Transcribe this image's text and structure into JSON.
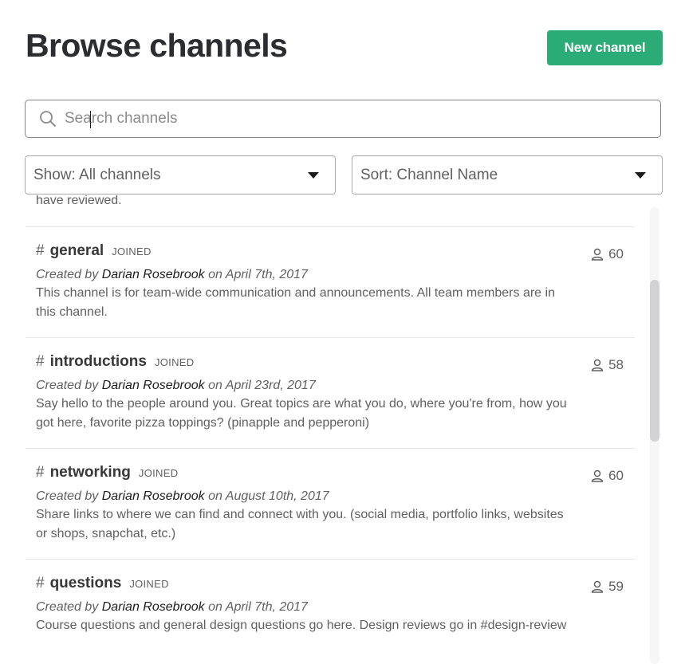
{
  "header": {
    "title": "Browse channels",
    "new_channel_label": "New channel"
  },
  "search": {
    "placeholder": "Search channels",
    "value": ""
  },
  "filters": {
    "show_label": "Show: All channels",
    "sort_label": "Sort: Channel Name"
  },
  "list": {
    "partial_text": "have reviewed.",
    "channels": [
      {
        "name": "general",
        "badge": "JOINED",
        "created_prefix": "Created by ",
        "creator": "Darian Rosebrook",
        "created_suffix": " on April 7th, 2017",
        "purpose": "This channel is for team-wide communication and announcements. All team members are in this channel.",
        "members": "60"
      },
      {
        "name": "introductions",
        "badge": "JOINED",
        "created_prefix": "Created by ",
        "creator": "Darian Rosebrook",
        "created_suffix": " on April 23rd, 2017",
        "purpose": "Say hello to the people around you. Great topics are what you do, where you're from, how you got here, favorite pizza toppings? (pinapple and pepperoni)",
        "members": "58"
      },
      {
        "name": "networking",
        "badge": "JOINED",
        "created_prefix": "Created by ",
        "creator": "Darian Rosebrook",
        "created_suffix": " on August 10th, 2017",
        "purpose": "Share links to where we can find and connect with you. (social media, portfolio links, websites or shops, snapchat, etc.)",
        "members": "60"
      },
      {
        "name": "questions",
        "badge": "JOINED",
        "created_prefix": "Created by ",
        "creator": "Darian Rosebrook",
        "created_suffix": " on April 7th, 2017",
        "purpose": "Course questions and general design questions go here. Design reviews go in #design-review",
        "members": "59"
      }
    ]
  },
  "colors": {
    "accent": "#2bac76",
    "text_primary": "#1d1c1d",
    "text_secondary": "#616061"
  },
  "icons": {
    "search": "search-icon",
    "members": "user-icon",
    "dropdown": "caret-down-icon"
  },
  "hash_symbol": "#"
}
